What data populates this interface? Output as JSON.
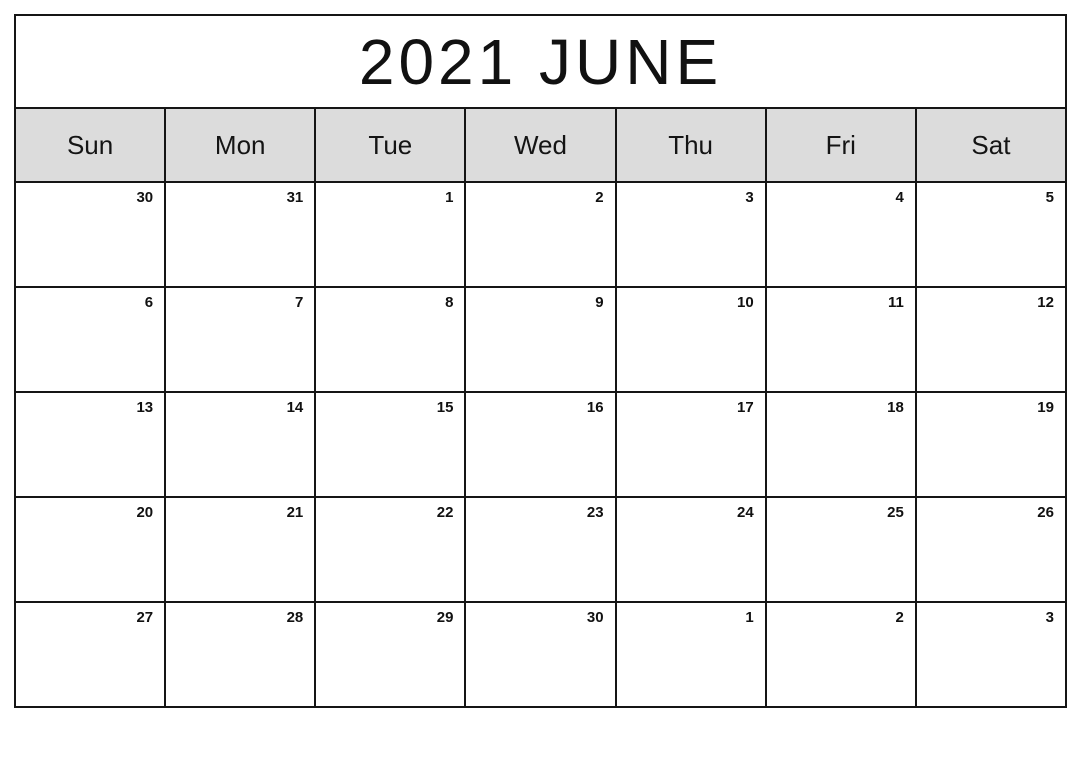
{
  "calendar": {
    "title": "2021 JUNE",
    "year": "2021",
    "month": "JUNE",
    "colors": {
      "header_background": "#dcdcdc",
      "border": "#151515",
      "cell_background": "#ffffff",
      "text": "#111111"
    },
    "weekdays": [
      {
        "short": "Sun"
      },
      {
        "short": "Mon"
      },
      {
        "short": "Tue"
      },
      {
        "short": "Wed"
      },
      {
        "short": "Thu"
      },
      {
        "short": "Fri"
      },
      {
        "short": "Sat"
      }
    ],
    "weeks": [
      {
        "days": [
          {
            "number": "30",
            "in_month": false
          },
          {
            "number": "31",
            "in_month": false
          },
          {
            "number": "1",
            "in_month": true
          },
          {
            "number": "2",
            "in_month": true
          },
          {
            "number": "3",
            "in_month": true
          },
          {
            "number": "4",
            "in_month": true
          },
          {
            "number": "5",
            "in_month": true
          }
        ]
      },
      {
        "days": [
          {
            "number": "6",
            "in_month": true
          },
          {
            "number": "7",
            "in_month": true
          },
          {
            "number": "8",
            "in_month": true
          },
          {
            "number": "9",
            "in_month": true
          },
          {
            "number": "10",
            "in_month": true
          },
          {
            "number": "11",
            "in_month": true
          },
          {
            "number": "12",
            "in_month": true
          }
        ]
      },
      {
        "days": [
          {
            "number": "13",
            "in_month": true
          },
          {
            "number": "14",
            "in_month": true
          },
          {
            "number": "15",
            "in_month": true
          },
          {
            "number": "16",
            "in_month": true
          },
          {
            "number": "17",
            "in_month": true
          },
          {
            "number": "18",
            "in_month": true
          },
          {
            "number": "19",
            "in_month": true
          }
        ]
      },
      {
        "days": [
          {
            "number": "20",
            "in_month": true
          },
          {
            "number": "21",
            "in_month": true
          },
          {
            "number": "22",
            "in_month": true
          },
          {
            "number": "23",
            "in_month": true
          },
          {
            "number": "24",
            "in_month": true
          },
          {
            "number": "25",
            "in_month": true
          },
          {
            "number": "26",
            "in_month": true
          }
        ]
      },
      {
        "days": [
          {
            "number": "27",
            "in_month": true
          },
          {
            "number": "28",
            "in_month": true
          },
          {
            "number": "29",
            "in_month": true
          },
          {
            "number": "30",
            "in_month": true
          },
          {
            "number": "1",
            "in_month": false
          },
          {
            "number": "2",
            "in_month": false
          },
          {
            "number": "3",
            "in_month": false
          }
        ]
      }
    ]
  }
}
